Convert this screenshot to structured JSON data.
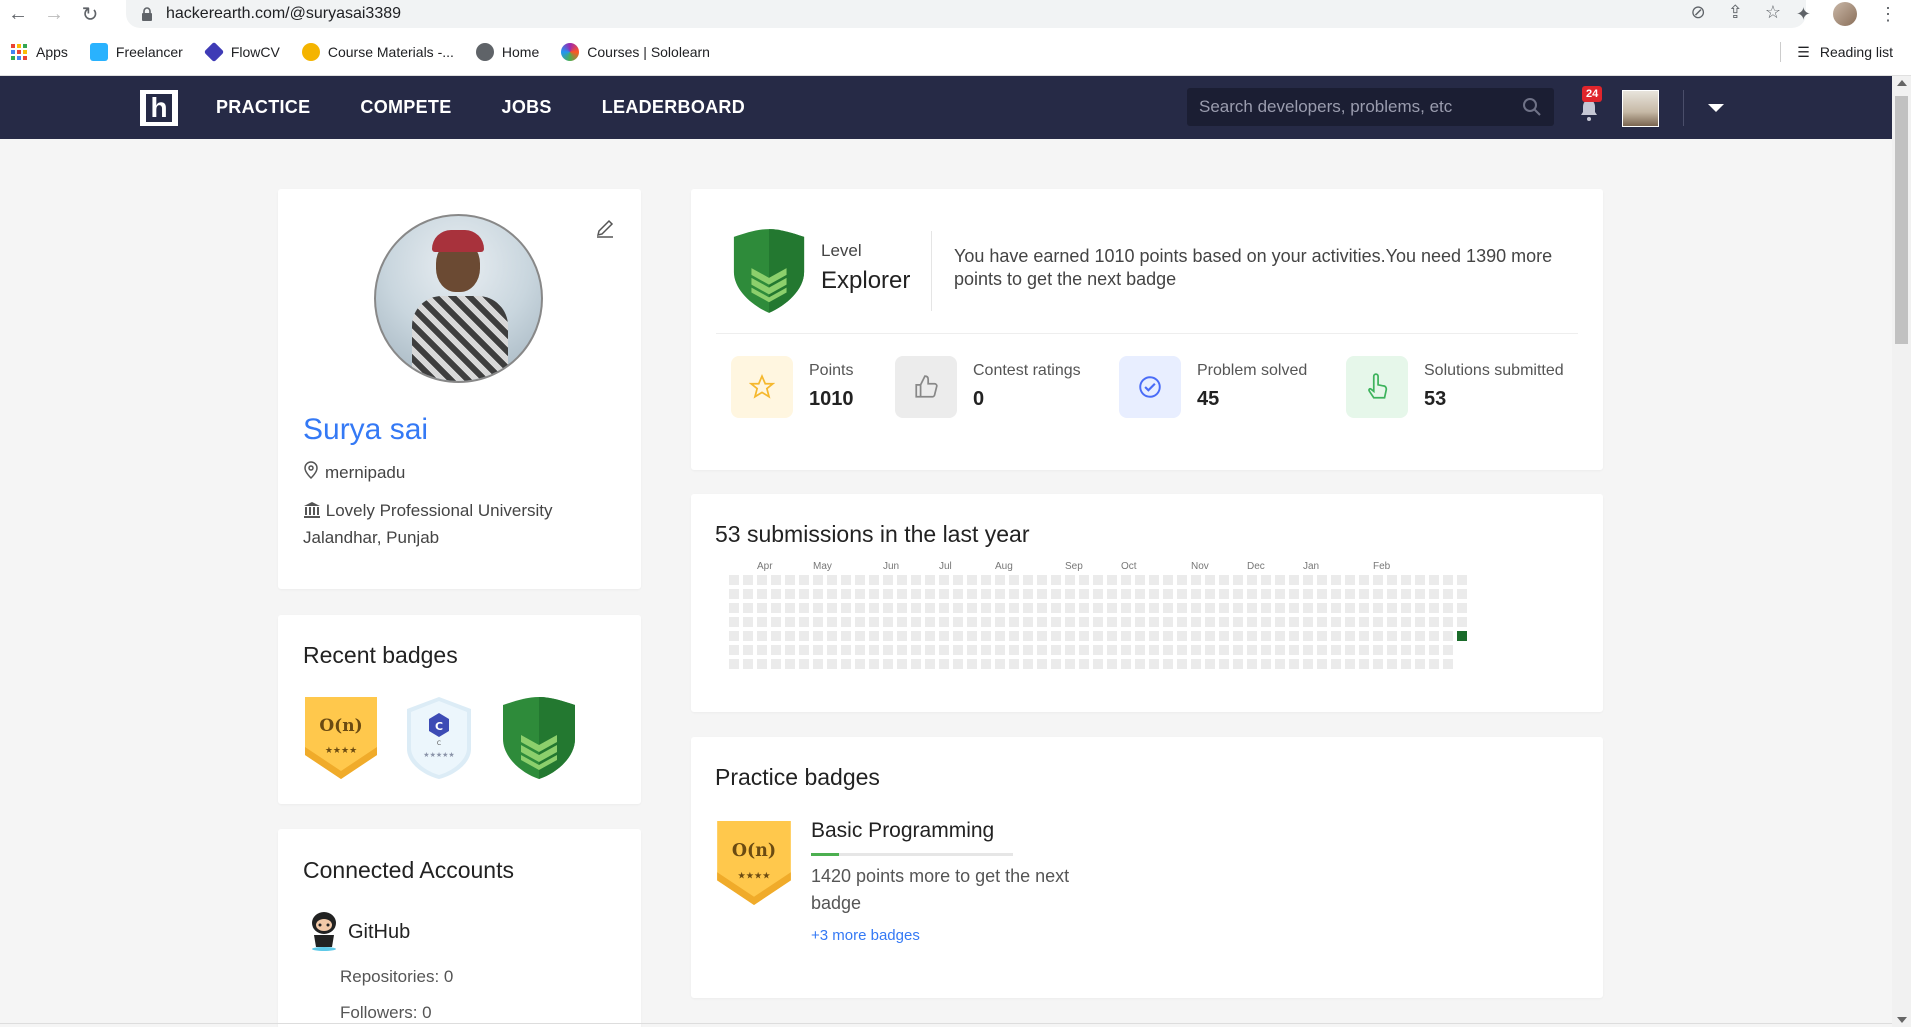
{
  "browser": {
    "url": "hackerearth.com/@suryasai3389",
    "bookmarks": [
      {
        "label": "Apps",
        "color": "#ea4335"
      },
      {
        "label": "Freelancer",
        "color": "#29b2fe"
      },
      {
        "label": "FlowCV",
        "color": "#3f3bb6"
      },
      {
        "label": "Course Materials -...",
        "color": "#f4b400"
      },
      {
        "label": "Home",
        "color": "#5f6368"
      },
      {
        "label": "Courses | Sololearn",
        "color": "#9c27b0"
      }
    ],
    "reading_list": "Reading list"
  },
  "nav": {
    "logo": "h",
    "menu": [
      "PRACTICE",
      "COMPETE",
      "JOBS",
      "LEADERBOARD"
    ],
    "search_placeholder": "Search developers, problems, etc",
    "notification_count": "24"
  },
  "profile": {
    "name": "Surya sai",
    "location": "mernipadu",
    "university": "Lovely Professional University Jalandhar, Punjab"
  },
  "recent_badges": {
    "title": "Recent badges",
    "badges": [
      {
        "label": "O(n)",
        "stars": "★★★★",
        "type": "gold"
      },
      {
        "label": "C",
        "sub": "C",
        "stars": "★★★★★",
        "type": "blue"
      },
      {
        "label": "",
        "type": "green"
      }
    ]
  },
  "connected_accounts": {
    "title": "Connected Accounts",
    "github": "GitHub",
    "repositories": "Repositories: 0",
    "followers": "Followers: 0"
  },
  "level": {
    "label": "Level",
    "name": "Explorer",
    "description": "You have earned 1010 points based on your activities.You need 1390 more points to get the next badge"
  },
  "stats": [
    {
      "label": "Points",
      "value": "1010",
      "icon": "star-icon",
      "bg": "#fff6e0",
      "color": "#f5b82e"
    },
    {
      "label": "Contest ratings",
      "value": "0",
      "icon": "thumbs-up-icon",
      "bg": "#ececec",
      "color": "#888"
    },
    {
      "label": "Problem solved",
      "value": "45",
      "icon": "check-circle-icon",
      "bg": "#e8eeff",
      "color": "#4a6cf7"
    },
    {
      "label": "Solutions submitted",
      "value": "53",
      "icon": "hand-pointer-icon",
      "bg": "#e6f7ea",
      "color": "#3db35c"
    }
  ],
  "submissions": {
    "title": "53 submissions in the last year",
    "months": [
      "Apr",
      "May",
      "Jun",
      "Jul",
      "Aug",
      "Sep",
      "Oct",
      "Nov",
      "Dec",
      "Jan",
      "Feb"
    ],
    "active_color": "#1a6b2a",
    "empty_color": "#ebebeb"
  },
  "practice_badges": {
    "title": "Practice badges",
    "badge_label": "O(n)",
    "badge_stars": "★★★★",
    "name": "Basic Programming",
    "progress_desc": "1420 points more to get the next badge",
    "more_link": "+3 more badges"
  }
}
